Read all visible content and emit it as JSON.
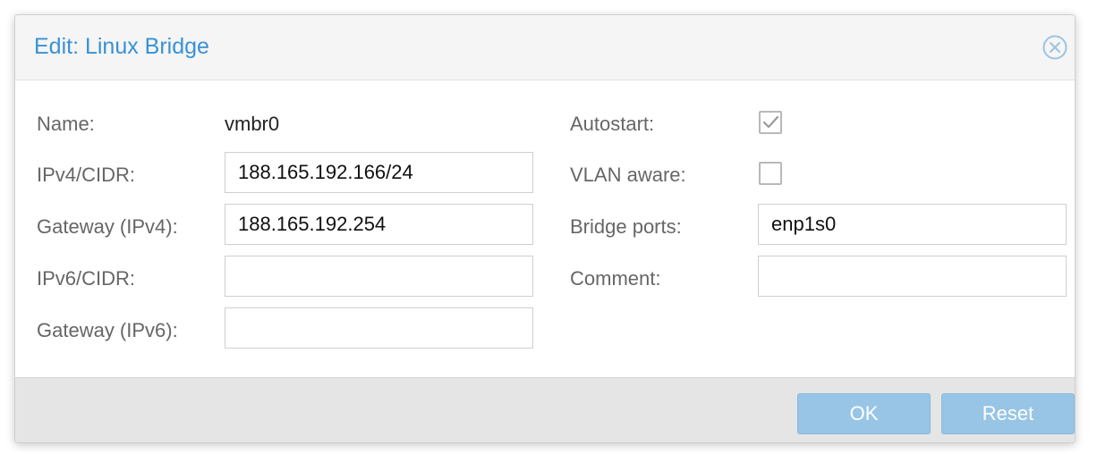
{
  "dialog": {
    "title": "Edit: Linux Bridge",
    "close_icon": "close-circle-icon"
  },
  "form": {
    "name": {
      "label": "Name:",
      "value": "vmbr0"
    },
    "ipv4_cidr": {
      "label": "IPv4/CIDR:",
      "value": "188.165.192.166/24"
    },
    "gateway_ipv4": {
      "label": "Gateway (IPv4):",
      "value": "188.165.192.254"
    },
    "ipv6_cidr": {
      "label": "IPv6/CIDR:",
      "value": ""
    },
    "gateway_ipv6": {
      "label": "Gateway (IPv6):",
      "value": ""
    },
    "autostart": {
      "label": "Autostart:",
      "checked": true
    },
    "vlan_aware": {
      "label": "VLAN aware:",
      "checked": false
    },
    "bridge_ports": {
      "label": "Bridge ports:",
      "value": "enp1s0"
    },
    "comment": {
      "label": "Comment:",
      "value": ""
    }
  },
  "footer": {
    "ok_label": "OK",
    "reset_label": "Reset"
  },
  "colors": {
    "title": "#3892d4",
    "button": "#98c5e6",
    "label": "#666666"
  }
}
